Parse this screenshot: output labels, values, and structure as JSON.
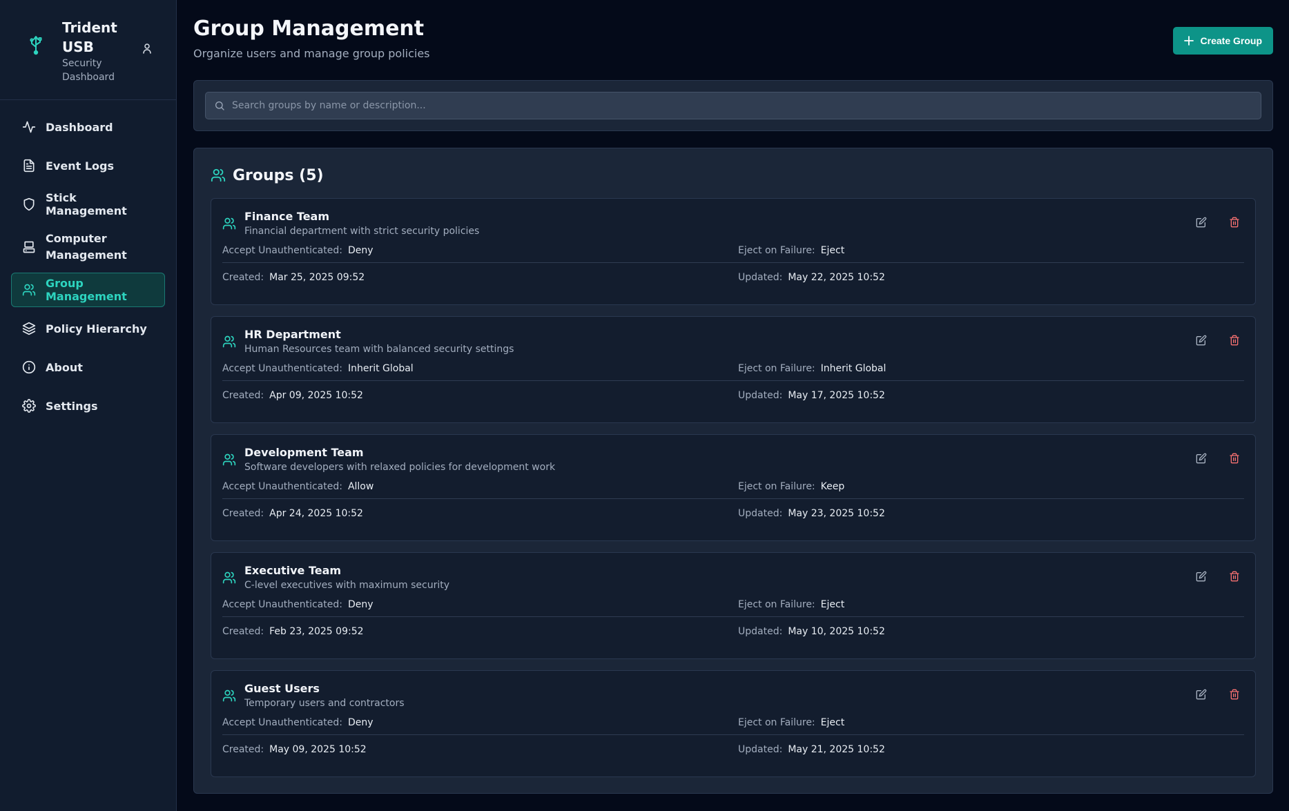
{
  "brand": {
    "name": "Trident USB",
    "subtitle": "Security Dashboard"
  },
  "nav": [
    {
      "label": "Dashboard",
      "icon": "activity-icon"
    },
    {
      "label": "Event Logs",
      "icon": "file-text-icon"
    },
    {
      "label": "Stick Management",
      "icon": "shield-icon"
    },
    {
      "label": "Computer Management",
      "icon": "computer-icon"
    },
    {
      "label": "Group Management",
      "icon": "users-icon",
      "active": true
    },
    {
      "label": "Policy Hierarchy",
      "icon": "layers-icon"
    },
    {
      "label": "About",
      "icon": "info-icon"
    },
    {
      "label": "Settings",
      "icon": "gear-icon"
    }
  ],
  "header": {
    "title": "Group Management",
    "subtitle": "Organize users and manage group policies",
    "create_label": "Create Group"
  },
  "search": {
    "placeholder": "Search groups by name or description...",
    "value": ""
  },
  "groups_title": "Groups (5)",
  "labels": {
    "accept": "Accept Unauthenticated:",
    "eject": "Eject on Failure:",
    "created": "Created:",
    "updated": "Updated:"
  },
  "groups": [
    {
      "name": "Finance Team",
      "description": "Financial department with strict security policies",
      "accept": "Deny",
      "eject": "Eject",
      "created": "Mar 25, 2025 09:52",
      "updated": "May 22, 2025 10:52"
    },
    {
      "name": "HR Department",
      "description": "Human Resources team with balanced security settings",
      "accept": "Inherit Global",
      "eject": "Inherit Global",
      "created": "Apr 09, 2025 10:52",
      "updated": "May 17, 2025 10:52"
    },
    {
      "name": "Development Team",
      "description": "Software developers with relaxed policies for development work",
      "accept": "Allow",
      "eject": "Keep",
      "created": "Apr 24, 2025 10:52",
      "updated": "May 23, 2025 10:52"
    },
    {
      "name": "Executive Team",
      "description": "C-level executives with maximum security",
      "accept": "Deny",
      "eject": "Eject",
      "created": "Feb 23, 2025 09:52",
      "updated": "May 10, 2025 10:52"
    },
    {
      "name": "Guest Users",
      "description": "Temporary users and contractors",
      "accept": "Deny",
      "eject": "Eject",
      "created": "May 09, 2025 10:52",
      "updated": "May 21, 2025 10:52"
    }
  ],
  "colors": {
    "accent": "#2dd4bf",
    "button": "#0d9488",
    "danger": "#f87171",
    "background": "#040a19",
    "panel": "#1b2638"
  }
}
